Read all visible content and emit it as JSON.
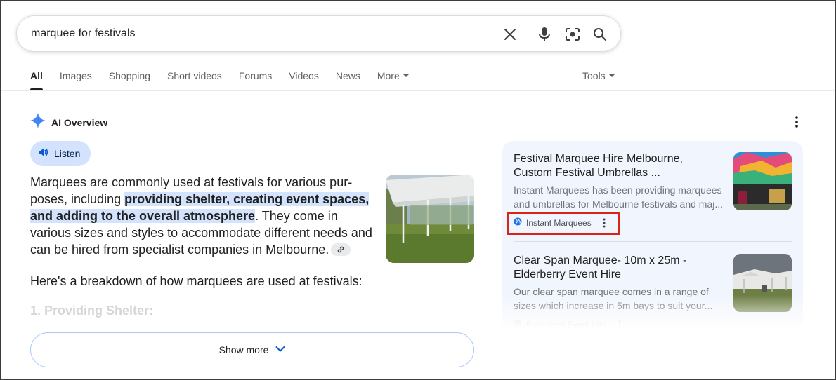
{
  "search": {
    "query": "marquee for festivals"
  },
  "tabs": [
    {
      "label": "All",
      "active": true
    },
    {
      "label": "Images"
    },
    {
      "label": "Shopping"
    },
    {
      "label": "Short videos"
    },
    {
      "label": "Forums"
    },
    {
      "label": "Videos"
    },
    {
      "label": "News"
    },
    {
      "label": "More",
      "dropdown": true
    }
  ],
  "tools_label": "Tools",
  "ai_overview": {
    "title": "AI Overview",
    "listen_label": "Listen",
    "para1_a": "Marquees are commonly used at festivals for various pur-poses, including ",
    "para1_highlight": "providing shelter, creating event spaces, and adding to the overall atmosphere",
    "para1_b": ". They come in various sizes and styles to accommodate different needs and can be hired from specialist companies in Melbourne.",
    "para2": "Here's a breakdown of how marquees are used at festivals:",
    "faded_heading": "1. Providing Shelter:",
    "show_more_label": "Show more"
  },
  "sources": [
    {
      "title": "Festival Marquee Hire Melbourne, Custom Festival Umbrellas ...",
      "snippet": "Instant Marquees has been providing marquees and umbrellas for Melbourne festivals and maj...",
      "source_name": "Instant Marquees"
    },
    {
      "title": "Clear Span Marquee- 10m x 25m - Elderberry Event Hire",
      "snippet": "Our clear span marquee comes in a range of sizes which increase in 5m bays to suit your...",
      "source_name": "Elderberry Event Hire"
    }
  ],
  "colors": {
    "accent_blue": "#1a73e8",
    "highlight": "#d3e3fd",
    "annotation_red": "#d9241c"
  }
}
